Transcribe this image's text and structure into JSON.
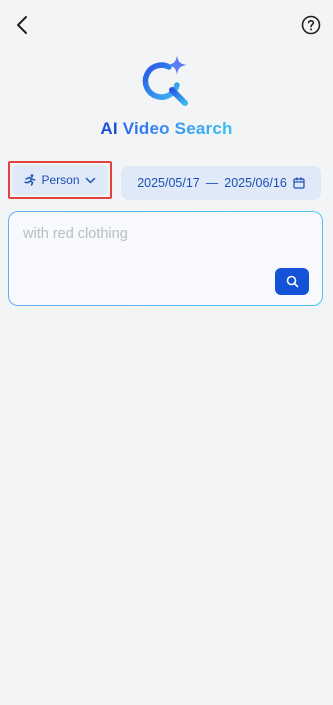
{
  "header": {
    "back_icon": "chevron-left-icon",
    "help_icon": "question-circle-icon"
  },
  "brand": {
    "title_ai": "AI",
    "title_rest": "Video Search",
    "logo_icon": "sparkle-search-icon"
  },
  "filters": {
    "type": {
      "label": "Person",
      "icon": "running-person-icon",
      "dropdown_icon": "chevron-down-icon"
    },
    "date_range": {
      "start": "2025/05/17",
      "separator": "—",
      "end": "2025/06/16",
      "icon": "calendar-icon"
    }
  },
  "search": {
    "placeholder": "with red clothing",
    "button_icon": "search-icon"
  },
  "colors": {
    "accent": "#1452d8",
    "highlight_border": "#e0433c",
    "chip_bg": "#dfe9f7",
    "background": "#f3f4f6"
  }
}
